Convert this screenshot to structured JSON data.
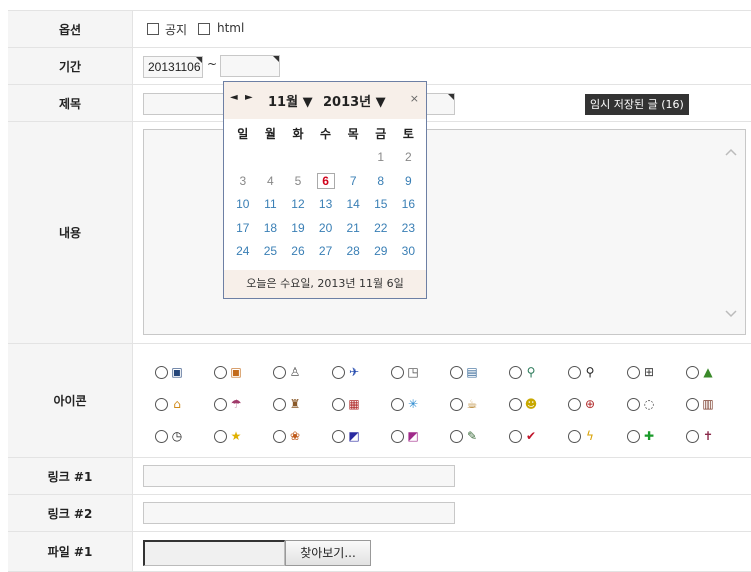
{
  "form": {
    "option_label": "옵션",
    "notice_label": "공지",
    "html_label": "html",
    "period_label": "기간",
    "start_date": "20131106",
    "tilde": "~",
    "end_date": "",
    "title_label": "제목",
    "title_value": "",
    "temp_saved": "임시 저장된 글 (16)",
    "content_label": "내용",
    "icon_label": "아이콘",
    "link1_label": "링크 #1",
    "link1_value": "",
    "link2_label": "링크 #2",
    "link2_value": "",
    "file1_label": "파일 #1",
    "browse_label": "찾아보기..."
  },
  "calendar": {
    "prev": "◄",
    "next": "►",
    "month": "11월 ▼",
    "year": "2013년 ▼",
    "close": "×",
    "weekdays": [
      "일",
      "월",
      "화",
      "수",
      "목",
      "금",
      "토"
    ],
    "weeks": [
      [
        "",
        "",
        "",
        "",
        "",
        "1",
        "2"
      ],
      [
        "3",
        "4",
        "5",
        "6",
        "7",
        "8",
        "9"
      ],
      [
        "10",
        "11",
        "12",
        "13",
        "14",
        "15",
        "16"
      ],
      [
        "17",
        "18",
        "19",
        "20",
        "21",
        "22",
        "23"
      ],
      [
        "24",
        "25",
        "26",
        "27",
        "28",
        "29",
        "30"
      ]
    ],
    "today": "6",
    "footer": "오늘은 수요일, 2013년 11월 6일"
  },
  "icons": [
    [
      "briefcase-icon",
      "toolbox-icon",
      "stamp-icon",
      "airplane-icon",
      "note-icon",
      "document-icon",
      "magnifier-icon",
      "magnifier-black-icon",
      "gift-icon",
      "landscape-icon"
    ],
    [
      "house-icon",
      "umbrella-icon",
      "printer-icon",
      "alarm-icon",
      "printer-person-icon",
      "snowflake-icon",
      "coffee-icon",
      "smiley-icon",
      "baseball-icon",
      "speech-bubble-icon",
      "book-icon"
    ],
    [
      "clock-icon",
      "star-icon",
      "basket-icon",
      "square-blue-icon",
      "square-magenta-icon",
      "pencil-icon",
      "checkmark-icon",
      "lightning-icon",
      "plus-green-icon",
      "cross-icon"
    ]
  ]
}
